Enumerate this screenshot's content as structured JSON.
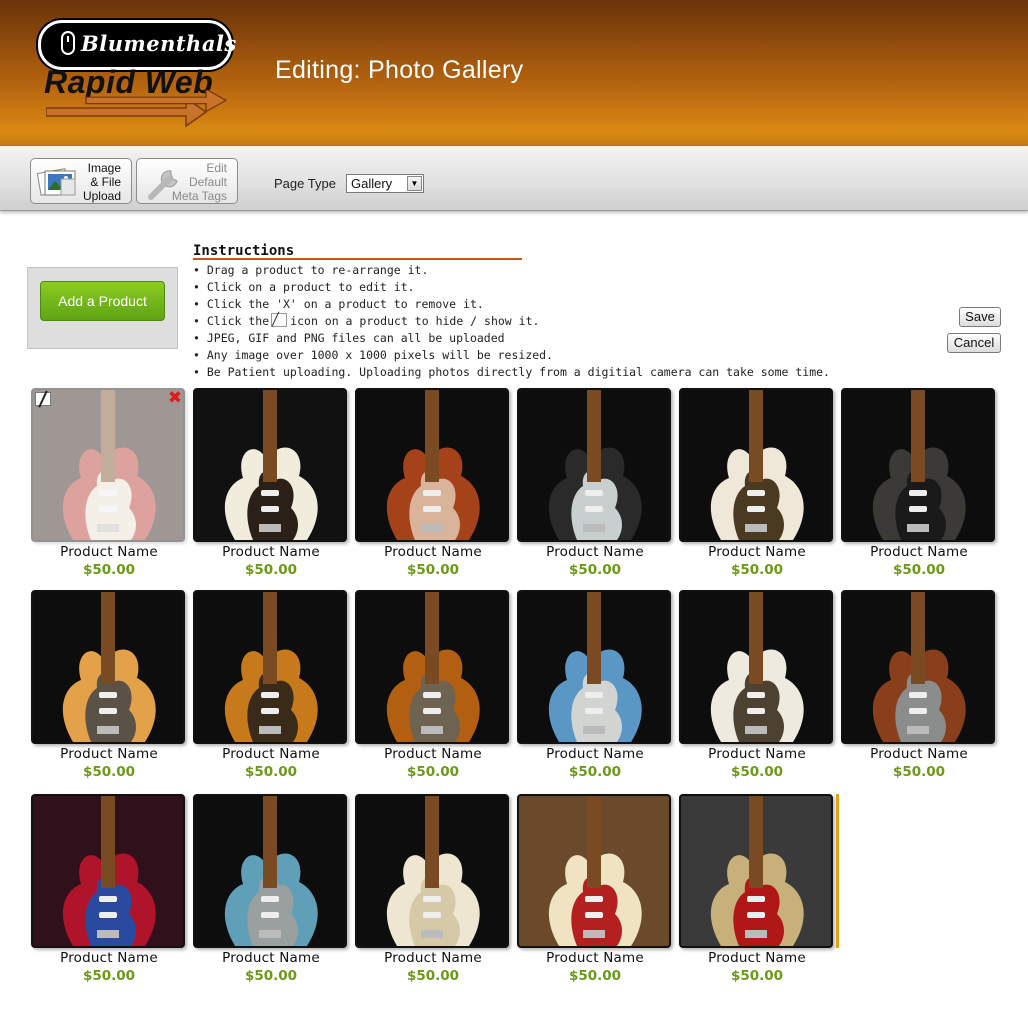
{
  "brand": {
    "logo_top": "Blumenthals",
    "logo_bottom": "Rapid Web"
  },
  "header": {
    "title": "Editing: Photo Gallery"
  },
  "toolbar": {
    "upload_label": [
      "Image",
      "& File",
      "Upload"
    ],
    "meta_label": [
      "Edit",
      "Default",
      "Meta Tags"
    ],
    "page_type_label": "Page Type",
    "page_type_value": "Gallery",
    "save_label": "Save",
    "cancel_label": "Cancel"
  },
  "add_product_label": "Add a Product",
  "instructions": {
    "title": "Instructions",
    "items": [
      "• Drag a product to re-arrange it.",
      "• Click on a product to edit it.",
      "• Click the 'X' on a product to remove it.",
      "• Click the",
      "• JPEG, GIF and PNG files can all be uploaded",
      "• Any image over 1000 x 1000 pixels will be resized.",
      "• Be Patient uploading. Uploading photos directly from a digitial camera can take some time."
    ],
    "item4_suffix": "icon on a product to hide / show it."
  },
  "products": [
    {
      "name": "Product Name",
      "price": "$50.00",
      "body": "#b8322a",
      "guard": "#e9dfcc",
      "bg": "#2a1a14",
      "hidden": true
    },
    {
      "name": "Product Name",
      "price": "$50.00",
      "body": "#f1ecdc",
      "guard": "#2a2018",
      "bg": "#111111",
      "hidden": false
    },
    {
      "name": "Product Name",
      "price": "$50.00",
      "body": "#a5421a",
      "guard": "#d9b49a",
      "bg": "#0d0d0d",
      "hidden": false
    },
    {
      "name": "Product Name",
      "price": "$50.00",
      "body": "#2a2a2a",
      "guard": "#c9cfcf",
      "bg": "#0d0d0d",
      "hidden": false
    },
    {
      "name": "Product Name",
      "price": "$50.00",
      "body": "#efe8d8",
      "guard": "#4a3a22",
      "bg": "#0d0d0d",
      "hidden": false
    },
    {
      "name": "Product Name",
      "price": "$50.00",
      "body": "#3b3a36",
      "guard": "#1a1a1a",
      "bg": "#0d0d0d",
      "hidden": false
    },
    {
      "name": "Product Name",
      "price": "$50.00",
      "body": "#e3a14a",
      "guard": "#5a5246",
      "bg": "#0d0d0d",
      "hidden": false
    },
    {
      "name": "Product Name",
      "price": "$50.00",
      "body": "#c77a1c",
      "guard": "#3a2a1a",
      "bg": "#0d0d0d",
      "hidden": false
    },
    {
      "name": "Product Name",
      "price": "$50.00",
      "body": "#b25f12",
      "guard": "#6e6350",
      "bg": "#0d0d0d",
      "hidden": false
    },
    {
      "name": "Product Name",
      "price": "$50.00",
      "body": "#5a97c4",
      "guard": "#d2d4d2",
      "bg": "#0d0d0d",
      "hidden": false
    },
    {
      "name": "Product Name",
      "price": "$50.00",
      "body": "#efeae0",
      "guard": "#4d4232",
      "bg": "#0d0d0d",
      "hidden": false
    },
    {
      "name": "Product Name",
      "price": "$50.00",
      "body": "#8a3f1c",
      "guard": "#8a8d8c",
      "bg": "#0d0d0d",
      "hidden": false
    },
    {
      "name": "Product Name",
      "price": "$50.00",
      "body": "#b0142a",
      "guard": "#2a4aa0",
      "bg": "#30101a",
      "hidden": false
    },
    {
      "name": "Product Name",
      "price": "$50.00",
      "body": "#5f9fb8",
      "guard": "#9aa0a0",
      "bg": "#0d0d0d",
      "hidden": false
    },
    {
      "name": "Product Name",
      "price": "$50.00",
      "body": "#efe6d2",
      "guard": "#d6c9a8",
      "bg": "#0d0d0d",
      "hidden": false
    },
    {
      "name": "Product Name",
      "price": "$50.00",
      "body": "#efe3c2",
      "guard": "#b42020",
      "bg": "#6a4a2a",
      "hidden": false
    },
    {
      "name": "Product Name",
      "price": "$50.00",
      "body": "#c8b07a",
      "guard": "#b01818",
      "bg": "#3a3a3a",
      "hidden": false
    }
  ],
  "colors": {
    "accent": "#d98a12",
    "price": "#6b9a17",
    "add_button": "#6fb41a",
    "remove": "#e01b1b",
    "drop_marker": "#e0a219"
  }
}
